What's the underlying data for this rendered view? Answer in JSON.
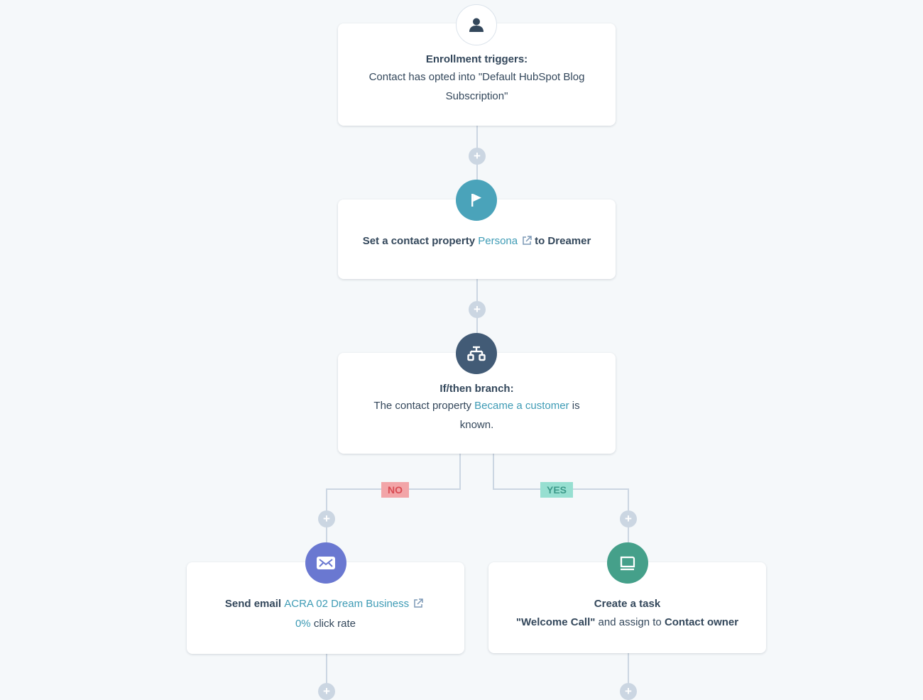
{
  "workflow": {
    "trigger": {
      "icon": "contact-icon",
      "title": "Enrollment triggers:",
      "text": "Contact has opted into \"Default HubSpot Blog Subscription\""
    },
    "set_property": {
      "icon": "flag-icon",
      "prefix": "Set a contact property",
      "property": "Persona",
      "suffix": "to Dreamer"
    },
    "branch": {
      "icon": "branch-icon",
      "title": "If/then branch:",
      "prefix": "The contact property",
      "property": "Became a customer",
      "suffix": "is known."
    },
    "branch_labels": {
      "no": "NO",
      "yes": "YES"
    },
    "send_email": {
      "icon": "email-icon",
      "prefix": "Send email",
      "email_name": "ACRA 02 Dream Business",
      "rate_value": "0%",
      "rate_label": "click rate"
    },
    "create_task": {
      "icon": "task-icon",
      "title": "Create a task",
      "task_name": "\"Welcome Call\"",
      "middle": "and assign to",
      "assignee": "Contact owner"
    },
    "add_action_symbol": "+"
  },
  "colors": {
    "background": "#f5f8fa",
    "connector": "#cbd6e2",
    "text": "#33475b",
    "link": "#3e9bb5",
    "flag_icon": "#4aa3ba",
    "branch_icon": "#425b76",
    "email_icon": "#6a78d1",
    "task_icon": "#45a08a",
    "no_bg": "#f2a5a8",
    "no_text": "#d94c53",
    "yes_bg": "#97dfd1",
    "yes_text": "#3d9a8a"
  }
}
